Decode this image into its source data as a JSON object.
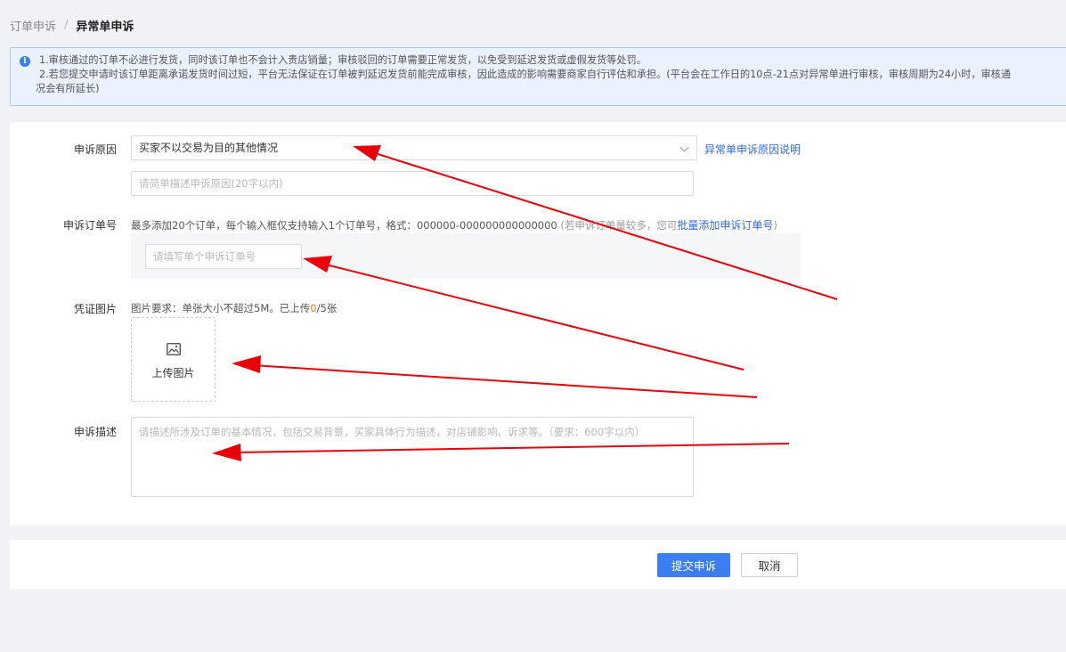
{
  "breadcrumb": {
    "parent": "订单申诉",
    "separator": "/",
    "current": "异常单申诉"
  },
  "notice": {
    "line1": "1.审核通过的订单不必进行发货，同时该订单也不会计入贵店销量；审核驳回的订单需要正常发货，以免受到延迟发货或虚假发货等处罚。",
    "line2": "2.若您提交申请时该订单距离承诺发货时间过短，平台无法保证在订单被判延迟发货前能完成审核，因此造成的影响需要商家自行评估和承担。(平台会在工作日的10点-21点对异常单进行审核，审核周期为24小时，审核通",
    "line3": "况会有所延长)"
  },
  "form": {
    "reason": {
      "label": "申诉原因",
      "selected": "买家不以交易为目的其他情况",
      "help_link": "异常单申诉原因说明",
      "brief_placeholder": "请简单描述申诉原因(20字以内)"
    },
    "order_numbers": {
      "label": "申诉订单号",
      "hint_main": "最多添加20个订单，每个输入框仅支持输入1个订单号，格式：000000-000000000000000",
      "hint_extra": " (若申诉订单量较多，您可",
      "batch_link": "批量添加申诉订单号",
      "hint_close": ")",
      "input_placeholder": "请填写单个申诉订单号"
    },
    "images": {
      "label": "凭证图片",
      "req_prefix": "图片要求：单张大小不超过5M。已上传",
      "uploaded": "0",
      "req_suffix": "/5张",
      "upload_label": "上传图片"
    },
    "description": {
      "label": "申诉描述",
      "placeholder": "请描述所涉及订单的基本情况，包括交易背景，买家具体行为描述，对店铺影响、诉求等。（要求：600字以内）"
    }
  },
  "actions": {
    "submit": "提交申诉",
    "cancel": "取消"
  },
  "colors": {
    "primary": "#3b7ef2",
    "link": "#2f6bd8",
    "annotation_arrow": "#e8000b",
    "uploaded_count": "#f07b1e"
  }
}
